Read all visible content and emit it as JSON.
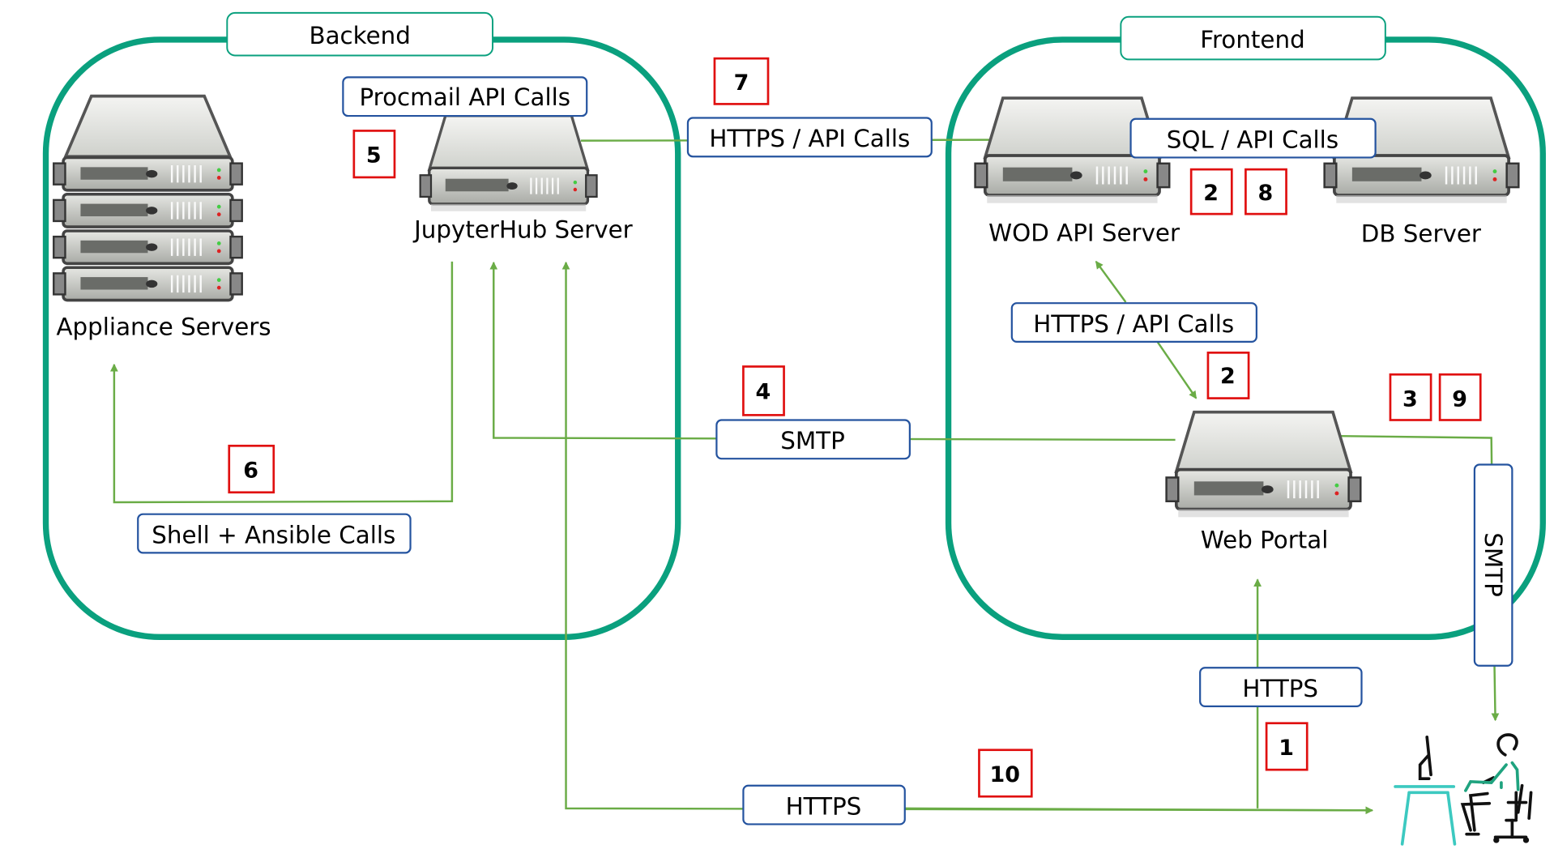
{
  "groups": {
    "backend": "Backend",
    "frontend": "Frontend"
  },
  "servers": {
    "appliance": "Appliance Servers",
    "jupyterhub": "JupyterHub Server",
    "wod_api": "WOD API Server",
    "db": "DB Server",
    "web_portal": "Web Portal"
  },
  "connections": {
    "procmail": "Procmail API Calls",
    "jupyter_to_wod": "HTTPS / API Calls",
    "sql": "SQL / API Calls",
    "portal_to_wod": "HTTPS / API Calls",
    "smtp_backend": "SMTP",
    "shell": "Shell + Ansible Calls",
    "user_https_portal": "HTTPS",
    "user_https_jupyter": "HTTPS",
    "smtp_user": "SMTP"
  },
  "steps": [
    "1",
    "2",
    "2",
    "3",
    "4",
    "5",
    "6",
    "7",
    "8",
    "9",
    "10"
  ],
  "colors": {
    "group": "#0aa07e",
    "connector": "#6aac46",
    "label_border": "#24539f",
    "step_border": "#e01010",
    "user_accent": "#1fa37f",
    "desk": "#3cc9c0"
  }
}
